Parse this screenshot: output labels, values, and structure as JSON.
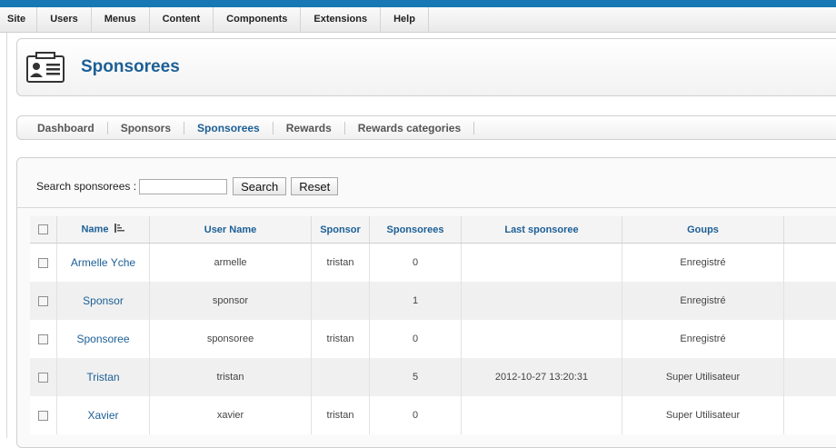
{
  "menubar": {
    "items": [
      "Site",
      "Users",
      "Menus",
      "Content",
      "Components",
      "Extensions",
      "Help"
    ]
  },
  "header": {
    "title": "Sponsorees",
    "icon": "user-card-icon"
  },
  "subnav": {
    "items": [
      "Dashboard",
      "Sponsors",
      "Sponsorees",
      "Rewards",
      "Rewards categories"
    ],
    "active": "Sponsorees"
  },
  "search": {
    "label": "Search sponsorees :",
    "value": "",
    "search_label": "Search",
    "reset_label": "Reset"
  },
  "table": {
    "columns": [
      "Name",
      "User Name",
      "Sponsor",
      "Sponsorees",
      "Last sponsoree",
      "Goups"
    ],
    "rows": [
      {
        "name": "Armelle Yche",
        "username": "armelle",
        "sponsor": "tristan",
        "sponsorees": "0",
        "last": "",
        "groups": "Enregistré"
      },
      {
        "name": "Sponsor",
        "username": "sponsor",
        "sponsor": "",
        "sponsorees": "1",
        "last": "",
        "groups": "Enregistré"
      },
      {
        "name": "Sponsoree",
        "username": "sponsoree",
        "sponsor": "tristan",
        "sponsorees": "0",
        "last": "",
        "groups": "Enregistré"
      },
      {
        "name": "Tristan",
        "username": "tristan",
        "sponsor": "",
        "sponsorees": "5",
        "last": "2012-10-27 13:20:31",
        "groups": "Super Utilisateur"
      },
      {
        "name": "Xavier",
        "username": "xavier",
        "sponsor": "tristan",
        "sponsorees": "0",
        "last": "",
        "groups": "Super Utilisateur"
      }
    ]
  },
  "colors": {
    "topbar": "#1778b4",
    "accent": "#1c5f96"
  }
}
